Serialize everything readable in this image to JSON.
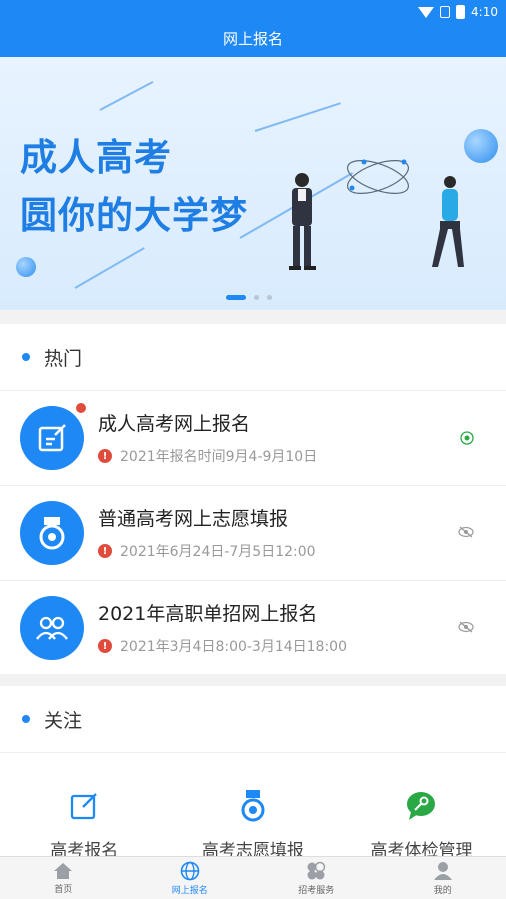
{
  "statusbar": {
    "time": "4:10"
  },
  "header": {
    "title": "网上报名"
  },
  "banner": {
    "line1": "成人高考",
    "line2": "圆你的大学梦"
  },
  "hot": {
    "title": "热门",
    "items": [
      {
        "title": "成人高考网上报名",
        "subtitle": "2021年报名时间9月4-9月10日",
        "status_icon": "eye-active-icon"
      },
      {
        "title": "普通高考网上志愿填报",
        "subtitle": "2021年6月24日-7月5日12:00",
        "status_icon": "eye-hidden-icon"
      },
      {
        "title": "2021年高职单招网上报名",
        "subtitle": "2021年3月4日8:00-3月14日18:00",
        "status_icon": "eye-hidden-icon"
      }
    ]
  },
  "follow": {
    "title": "关注",
    "items": [
      {
        "label": "高考报名",
        "icon": "edit-icon"
      },
      {
        "label": "高考志愿填报",
        "icon": "medal-icon"
      },
      {
        "label": "高考体检管理",
        "icon": "key-chat-icon"
      }
    ]
  },
  "tabbar": {
    "items": [
      {
        "label": "首页",
        "icon": "home-icon"
      },
      {
        "label": "网上报名",
        "icon": "globe-icon"
      },
      {
        "label": "招考服务",
        "icon": "services-icon"
      },
      {
        "label": "我的",
        "icon": "user-icon"
      }
    ]
  },
  "colors": {
    "primary": "#1e88f5",
    "alert": "#e04b3c",
    "success": "#2aa845"
  }
}
